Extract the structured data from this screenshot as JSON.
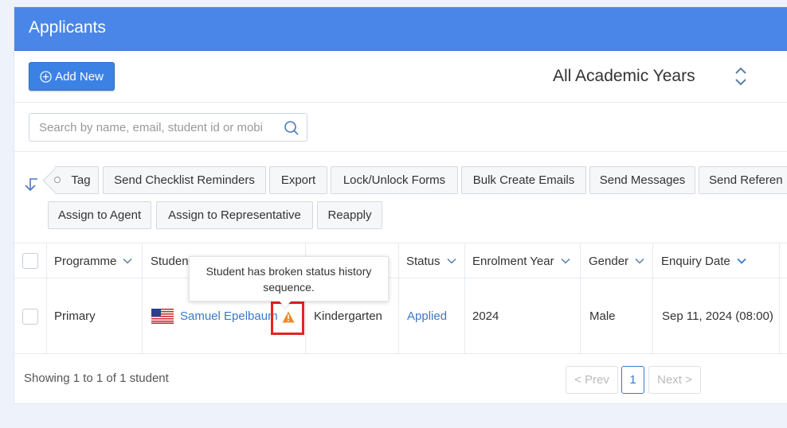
{
  "header": {
    "title": "Applicants"
  },
  "toolbar": {
    "add_label": "Add New",
    "academic_year": "All Academic Years"
  },
  "search": {
    "placeholder": "Search by name, email, student id or mobi"
  },
  "actions": [
    {
      "label": "Tag"
    },
    {
      "label": "Send Checklist Reminders"
    },
    {
      "label": "Export"
    },
    {
      "label": "Lock/Unlock Forms"
    },
    {
      "label": "Bulk Create Emails"
    },
    {
      "label": "Send Messages"
    },
    {
      "label": "Send Referen"
    },
    {
      "label": "Assign to Agent"
    },
    {
      "label": "Assign to Representative"
    },
    {
      "label": "Reapply"
    }
  ],
  "table": {
    "columns": [
      "Programme",
      "Studen",
      "Status",
      "Enrolment Year",
      "Gender",
      "Enquiry Date"
    ],
    "rows": [
      {
        "programme": "Primary",
        "student": "Samuel Epelbaum",
        "grade": "Kindergarten",
        "status": "Applied",
        "enrolment_year": "2024",
        "gender": "Male",
        "enquiry_date": "Sep 11, 2024 (08:00)"
      }
    ]
  },
  "tooltip": {
    "line1": "Student has broken status history",
    "line2": "sequence."
  },
  "footer": {
    "summary": "Showing 1 to 1 of 1 student",
    "prev": "< Prev",
    "page": "1",
    "next": "Next >"
  },
  "colors": {
    "header": "#4a86e8",
    "link": "#3a78c9",
    "warning": "#f08a24",
    "highlight": "#e8231f"
  }
}
